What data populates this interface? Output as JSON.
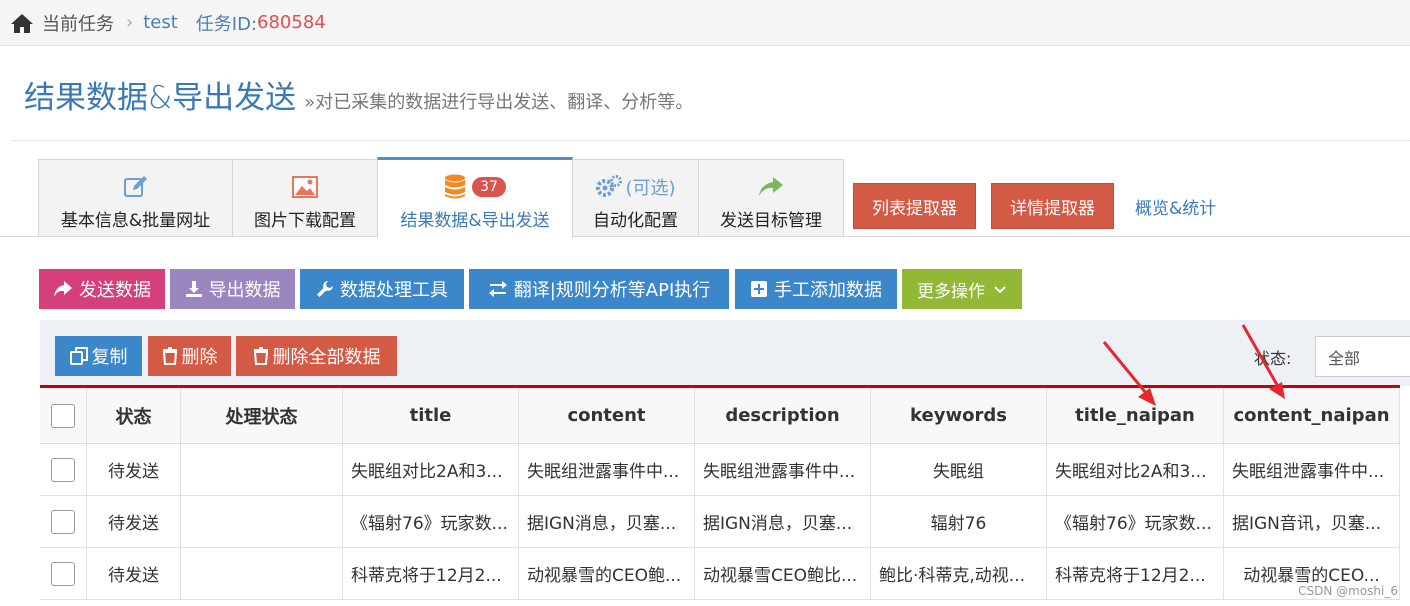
{
  "breadcrumb": {
    "home_icon": "home-icon",
    "current": "当前任务",
    "separator": "›",
    "task_name": "test",
    "task_id_label": "任务ID:",
    "task_id": "680584"
  },
  "page": {
    "title": "结果数据&导出发送",
    "subtitle": "»对已采集的数据进行导出发送、翻译、分析等。"
  },
  "tabs": [
    {
      "label": "基本信息&批量网址",
      "icon": "edit-icon"
    },
    {
      "label": "图片下载配置",
      "icon": "image-icon"
    },
    {
      "label": "结果数据&导出发送",
      "icon": "database-icon",
      "badge": "37",
      "active": true
    },
    {
      "label": "自动化配置",
      "icon": "gears-icon",
      "icon_text": "(可选)"
    },
    {
      "label": "发送目标管理",
      "icon": "share-arrow-icon"
    }
  ],
  "top_buttons": {
    "list_extractor": "列表提取器",
    "detail_extractor": "详情提取器",
    "overview_link": "概览&统计"
  },
  "actions": {
    "send_data": "发送数据",
    "export_data": "导出数据",
    "data_tools": "数据处理工具",
    "api_exec": "翻译|规则分析等API执行",
    "manual_add": "手工添加数据",
    "more_ops": "更多操作"
  },
  "panel": {
    "copy": "复制",
    "delete": "删除",
    "delete_all": "删除全部数据",
    "state_label": "状态:",
    "state_value": "全部"
  },
  "table": {
    "headers": [
      "状态",
      "处理状态",
      "title",
      "content",
      "description",
      "keywords",
      "title_naipan",
      "content_naipan"
    ],
    "rows": [
      [
        "待发送",
        "",
        "失眠组对比2A和3...",
        "失眠组泄露事件中...",
        "失眠组泄露事件中...",
        "失眠组",
        "失眠组对比2A和3...",
        "失眠组泄露事件中..."
      ],
      [
        "待发送",
        "",
        "《辐射76》玩家数...",
        "据IGN消息，贝塞...",
        "据IGN消息，贝塞...",
        "辐射76",
        "《辐射76》玩家数...",
        "据IGN音讯，贝塞..."
      ],
      [
        "待发送",
        "",
        "科蒂克将于12月2...",
        "动视暴雪的CEO鲍...",
        "动视暴雪CEO鲍比...",
        "鲍比·科蒂克,动视...",
        "科蒂克将于12月2...",
        "动视暴雪的CEO..."
      ]
    ]
  },
  "watermark": "CSDN @moshi_6",
  "colors": {
    "accent": "#3a79b3",
    "danger": "#d35a45",
    "pink": "#d6407a",
    "purple": "#9b86c0",
    "blue": "#3b87c9",
    "green": "#93b835",
    "arrow": "#e8262d"
  }
}
